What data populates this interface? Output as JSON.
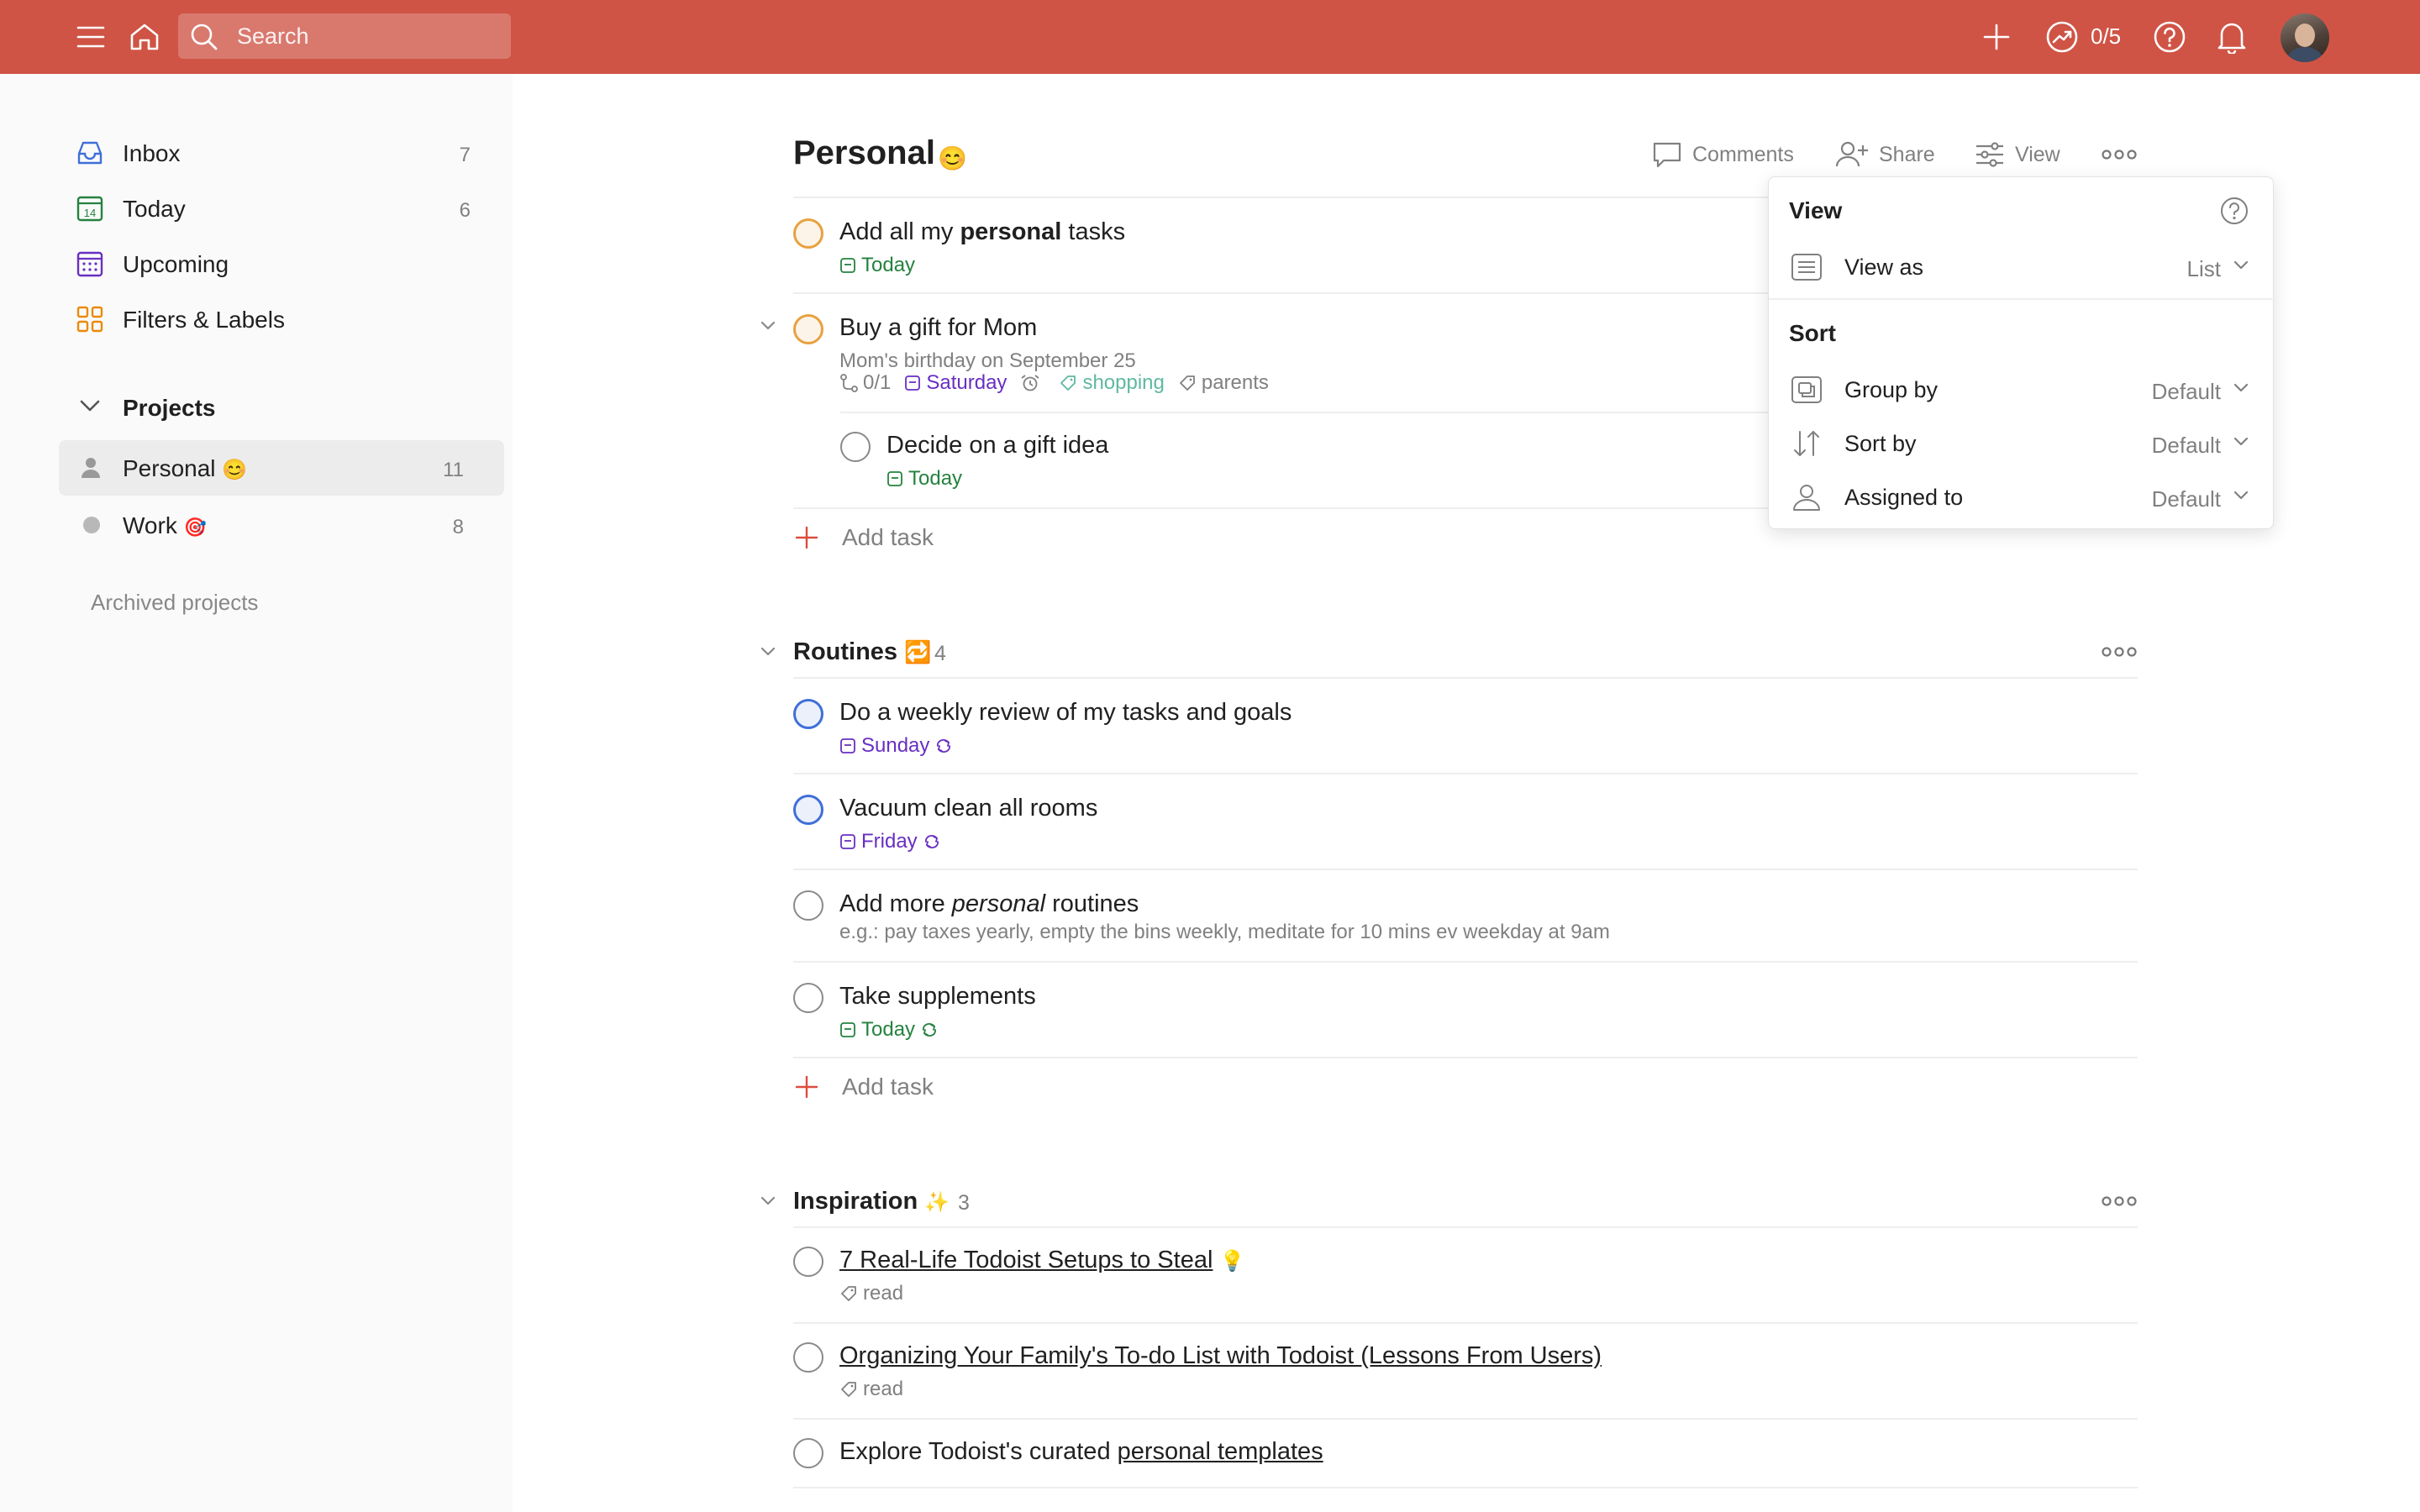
{
  "topbar": {
    "search_placeholder": "Search",
    "karma": "0/5"
  },
  "sidebar": {
    "nav": [
      {
        "label": "Inbox",
        "count": "7"
      },
      {
        "label": "Today",
        "count": "6",
        "icon_text": "14"
      },
      {
        "label": "Upcoming",
        "count": ""
      },
      {
        "label": "Filters & Labels",
        "count": ""
      }
    ],
    "projects_label": "Projects",
    "projects": [
      {
        "label": "Personal",
        "emoji": "😊",
        "count": "11"
      },
      {
        "label": "Work",
        "emoji": "🎯",
        "count": "8"
      }
    ],
    "archived": "Archived projects"
  },
  "header": {
    "title": "Personal",
    "title_emoji": "😊",
    "comments": "Comments",
    "share": "Share",
    "view": "View"
  },
  "tasks_top": [
    {
      "title_pre": "Add all my ",
      "title_bold": "personal",
      "title_post": " tasks",
      "date": "Today"
    },
    {
      "title": "Buy a gift for Mom",
      "desc": "Mom's birthday on September 25",
      "subtasks": "0/1",
      "date": "Saturday",
      "label1": "shopping",
      "label2": "parents"
    },
    {
      "title": "Decide on a gift idea",
      "date": "Today"
    }
  ],
  "add_task": "Add task",
  "sections": [
    {
      "name": "Routines",
      "emoji": "🔁",
      "count": "4",
      "tasks": [
        {
          "title": "Do a weekly review of my tasks and goals",
          "date": "Sunday"
        },
        {
          "title": "Vacuum clean all rooms",
          "date": "Friday"
        },
        {
          "title_pre": "Add more ",
          "title_italic": "personal",
          "title_post": " routines",
          "desc": "e.g.: pay taxes yearly, empty the bins weekly, meditate for 10 mins ev weekday at 9am"
        },
        {
          "title": "Take supplements",
          "date": "Today"
        }
      ]
    },
    {
      "name": "Inspiration",
      "emoji": "✨",
      "count": "3",
      "tasks": [
        {
          "title": "7 Real-Life Todoist Setups to Steal",
          "emoji": "💡",
          "label": "read"
        },
        {
          "title": "Organizing Your Family's To-do List with Todoist (Lessons From Users)",
          "label": "read"
        },
        {
          "title_pre": "Explore Todoist's curated ",
          "title_link": "personal templates"
        }
      ]
    }
  ],
  "view_panel": {
    "title": "View",
    "view_as_label": "View as",
    "view_as_value": "List",
    "sort_title": "Sort",
    "rows": [
      {
        "label": "Group by",
        "value": "Default"
      },
      {
        "label": "Sort by",
        "value": "Default"
      },
      {
        "label": "Assigned to",
        "value": "Default"
      }
    ]
  },
  "colors": {
    "brand": "#cf5446",
    "today_green": "#25823e",
    "date_purple": "#692fc2",
    "priority_orange": "#e8a140",
    "priority_blue": "#3f6fd8"
  }
}
